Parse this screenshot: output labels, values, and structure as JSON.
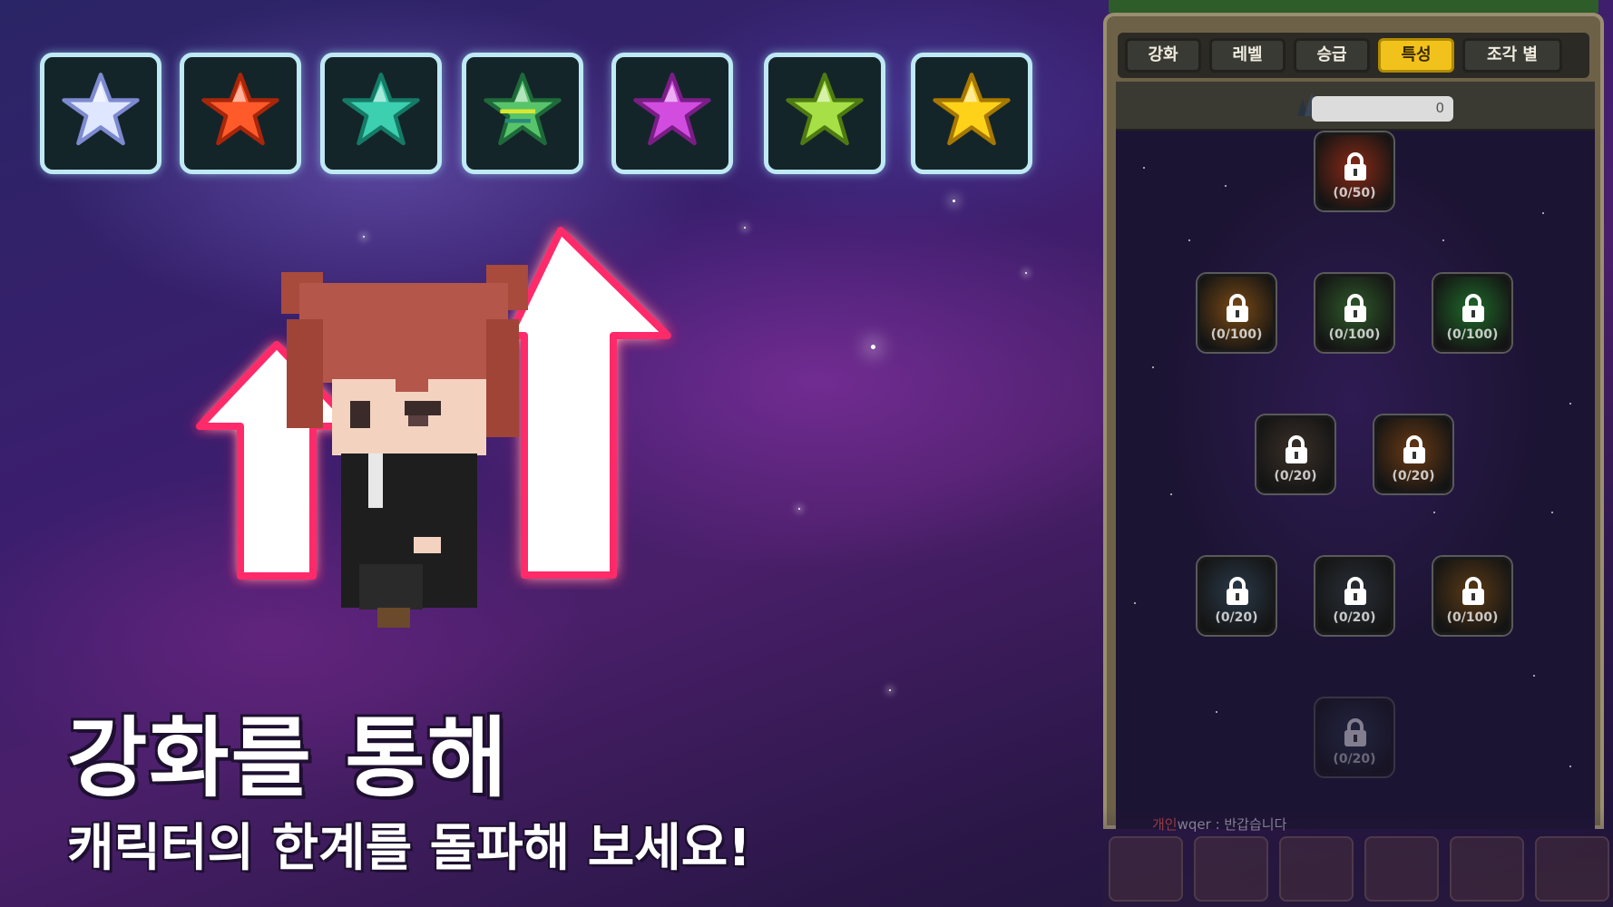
{
  "star_tiles": [
    {
      "name": "white",
      "fill": "#dfe6ff",
      "stroke": "#7d8ad0"
    },
    {
      "name": "red",
      "fill": "#ff5a2a",
      "stroke": "#a8260a"
    },
    {
      "name": "teal",
      "fill": "#3ccfb0",
      "stroke": "#157a66"
    },
    {
      "name": "green-stripe",
      "fill": "#58c46a",
      "stroke": "#1e6a3a"
    },
    {
      "name": "purple",
      "fill": "#d24ce0",
      "stroke": "#7a1e86"
    },
    {
      "name": "lime",
      "fill": "#a6e046",
      "stroke": "#4e7a12"
    },
    {
      "name": "gold",
      "fill": "#ffd21a",
      "stroke": "#a67800"
    }
  ],
  "headline": "강화를 통해",
  "subline": "캐릭터의 한계를 돌파해 보세요!",
  "panel": {
    "tabs": [
      "강화",
      "레벨",
      "승급",
      "특성",
      "조각 별"
    ],
    "active_tab": 3,
    "resource_value": "0",
    "nodes": [
      {
        "count": "(0/50)",
        "color": "#8a2a16"
      },
      {
        "count": "(0/100)",
        "color": "#7a4a14"
      },
      {
        "count": "(0/100)",
        "color": "#2f5a2a"
      },
      {
        "count": "(0/100)",
        "color": "#1f6a2a"
      },
      {
        "count": "(0/20)",
        "color": "#3a3028"
      },
      {
        "count": "(0/20)",
        "color": "#6a3a14"
      },
      {
        "count": "(0/20)",
        "color": "#2a3a4a"
      },
      {
        "count": "(0/20)",
        "color": "#2a3038"
      },
      {
        "count": "(0/100)",
        "color": "#5a3a16"
      },
      {
        "count": "(0/20)",
        "color": "#2a3a50"
      }
    ]
  },
  "chat": {
    "name": "개인",
    "text": "wqer : 반갑습니다"
  },
  "colors": {
    "arrow_glow": "#ff2a6a",
    "tab_active": "#f1c21b",
    "tile_border": "#bfe9f4"
  }
}
